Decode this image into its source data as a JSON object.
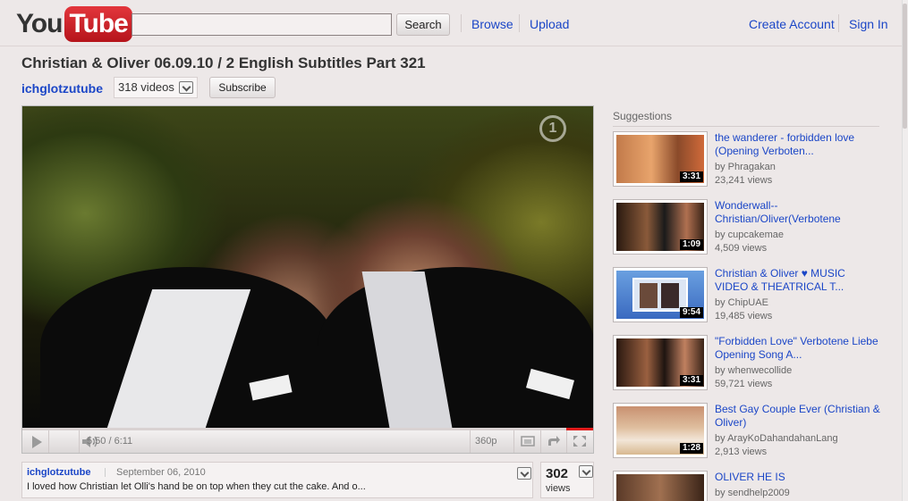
{
  "header": {
    "logo_you": "You",
    "logo_tube": "Tube",
    "search_button": "Search",
    "search_value": "",
    "nav_browse": "Browse",
    "nav_upload": "Upload",
    "nav_create_account": "Create Account",
    "nav_sign_in": "Sign In"
  },
  "video": {
    "title": "Christian & Oliver 06.09.10 / 2 English Subtitles Part 321",
    "channel": "ichglotzutube",
    "video_count": "318 videos",
    "subscribe": "Subscribe",
    "channel_logo": "1",
    "time": "5:50 / 6:11",
    "progress_fraction": 0.946,
    "quality": "360p"
  },
  "info": {
    "uploader": "ichglotzutube",
    "date": "September 06, 2010",
    "description": "I loved how Christian let Olli's hand be on top when they cut the cake. And o...",
    "views_count": "302",
    "views_label": "views"
  },
  "suggestions": {
    "heading": "Suggestions",
    "items": [
      {
        "title": "the wanderer - forbidden love (Opening Verboten...",
        "by": "by Phragakan",
        "views": "23,241 views",
        "duration": "3:31"
      },
      {
        "title": "Wonderwall--Christian/Oliver(Verbotene",
        "by": "by cupcakemae",
        "views": "4,509 views",
        "duration": "1:09"
      },
      {
        "title": "Christian & Oliver ♥ MUSIC VIDEO & THEATRICAL T...",
        "by": "by ChipUAE",
        "views": "19,485 views",
        "duration": "9:54"
      },
      {
        "title": "\"Forbidden Love\" Verbotene Liebe Opening Song A...",
        "by": "by whenwecollide",
        "views": "59,721 views",
        "duration": "3:31"
      },
      {
        "title": "Best Gay Couple Ever (Christian & Oliver)",
        "by": "by ArayKoDahandahanLang",
        "views": "2,913 views",
        "duration": "1:28"
      },
      {
        "title": "OLIVER HE IS",
        "by": "by sendhelp2009",
        "views": "",
        "duration": ""
      }
    ]
  },
  "colors": {
    "link": "#1b46c7",
    "logo_red": "#d5222a",
    "background": "#ede8e8"
  }
}
